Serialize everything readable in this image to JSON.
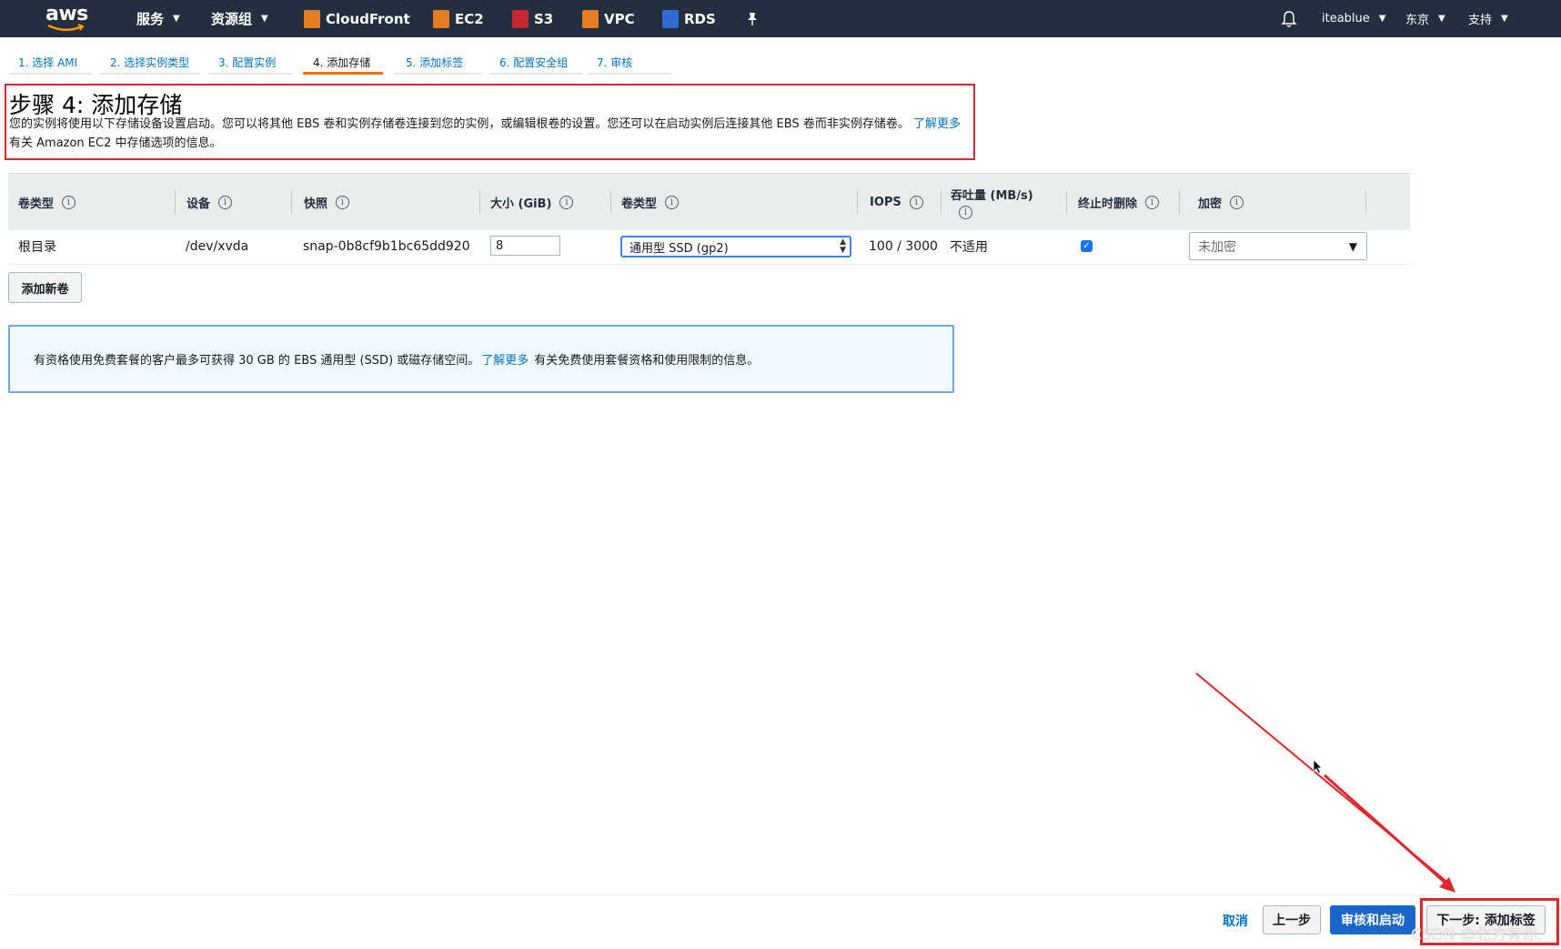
{
  "nav": {
    "logo": "aws",
    "services": "服务",
    "resource_groups": "资源组",
    "shortcuts": [
      {
        "label": "CloudFront",
        "color": "#e57b23"
      },
      {
        "label": "EC2",
        "color": "#e57b23"
      },
      {
        "label": "S3",
        "color": "#c7282d"
      },
      {
        "label": "VPC",
        "color": "#e57b23"
      },
      {
        "label": "RDS",
        "color": "#2e6cd1"
      }
    ],
    "user": "iteablue",
    "region": "东京",
    "support": "支持"
  },
  "steps": [
    {
      "label": "1. 选择 AMI",
      "active": false
    },
    {
      "label": "2. 选择实例类型",
      "active": false
    },
    {
      "label": "3. 配置实例",
      "active": false
    },
    {
      "label": "4. 添加存储",
      "active": true
    },
    {
      "label": "5. 添加标签",
      "active": false
    },
    {
      "label": "6. 配置安全组",
      "active": false
    },
    {
      "label": "7. 审核",
      "active": false
    }
  ],
  "page": {
    "title": "步骤 4: 添加存储",
    "desc_main": "您的实例将使用以下存储设备设置启动。您可以将其他 EBS 卷和实例存储卷连接到您的实例，或编辑根卷的设置。您还可以在启动实例后连接其他 EBS 卷而非实例存储卷。",
    "desc_link": "了解更多",
    "desc_tail": "有关 Amazon EC2 中存储选项的信息。"
  },
  "table": {
    "headers": {
      "volume_type": "卷类型",
      "device": "设备",
      "snapshot": "快照",
      "size": "大小 (GiB)",
      "vol_kind": "卷类型",
      "iops": "IOPS",
      "throughput": "吞吐量 (MB/s)",
      "delete_on_term": "终止时删除",
      "encryption": "加密"
    },
    "row": {
      "volume_type": "根目录",
      "device": "/dev/xvda",
      "snapshot": "snap-0b8cf9b1bc65dd920",
      "size": "8",
      "vol_kind": "通用型 SSD (gp2)",
      "iops": "100 / 3000",
      "throughput": "不适用",
      "delete_on_term": true,
      "encryption": "未加密"
    }
  },
  "add_volume": "添加新卷",
  "notice": {
    "text": "有资格使用免费套餐的客户最多可获得 30 GB 的 EBS 通用型 (SSD) 或磁存储空间。",
    "link": "了解更多",
    "tail": "有关免费使用套餐资格和使用限制的信息。"
  },
  "footer": {
    "cancel": "取消",
    "previous": "上一步",
    "review_launch": "审核和启动",
    "next": "下一步: 添加标签"
  },
  "watermark": "CSDN @北方有你.",
  "annotation_color": "#e0262b"
}
